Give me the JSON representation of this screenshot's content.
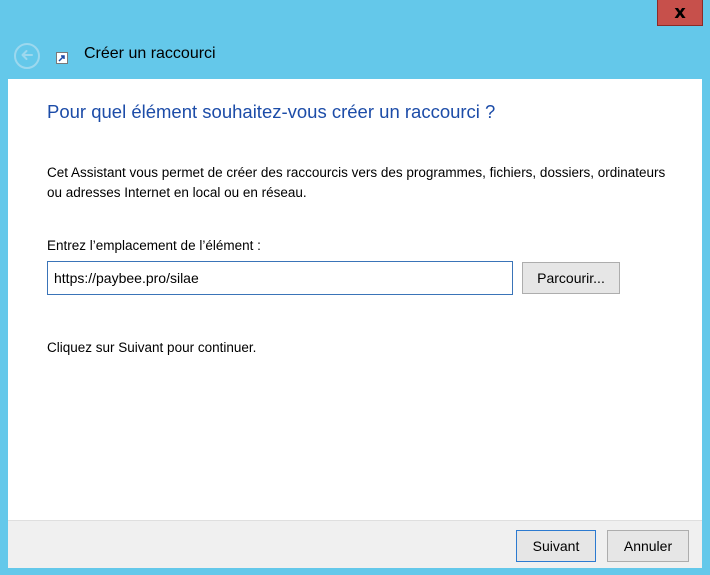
{
  "window": {
    "title": "Créer un raccourci",
    "close_label": "x",
    "icons": {
      "back": "back-arrow-icon",
      "shortcut": "shortcut-icon",
      "close": "close-icon"
    }
  },
  "wizard": {
    "heading": "Pour quel élément souhaitez-vous créer un raccourci ?",
    "description": "Cet Assistant vous permet de créer des raccourcis vers des programmes, fichiers, dossiers, ordinateurs ou adresses Internet en local ou en réseau.",
    "location_label": "Entrez l’emplacement de l’élément :",
    "location_value": "https://paybee.pro/silae",
    "browse_label": "Parcourir...",
    "continue_hint": "Cliquez sur Suivant pour continuer."
  },
  "footer": {
    "next_label": "Suivant",
    "cancel_label": "Annuler"
  },
  "colors": {
    "frame": "#64c8ea",
    "heading": "#1c4ca8",
    "close": "#c7504b"
  }
}
